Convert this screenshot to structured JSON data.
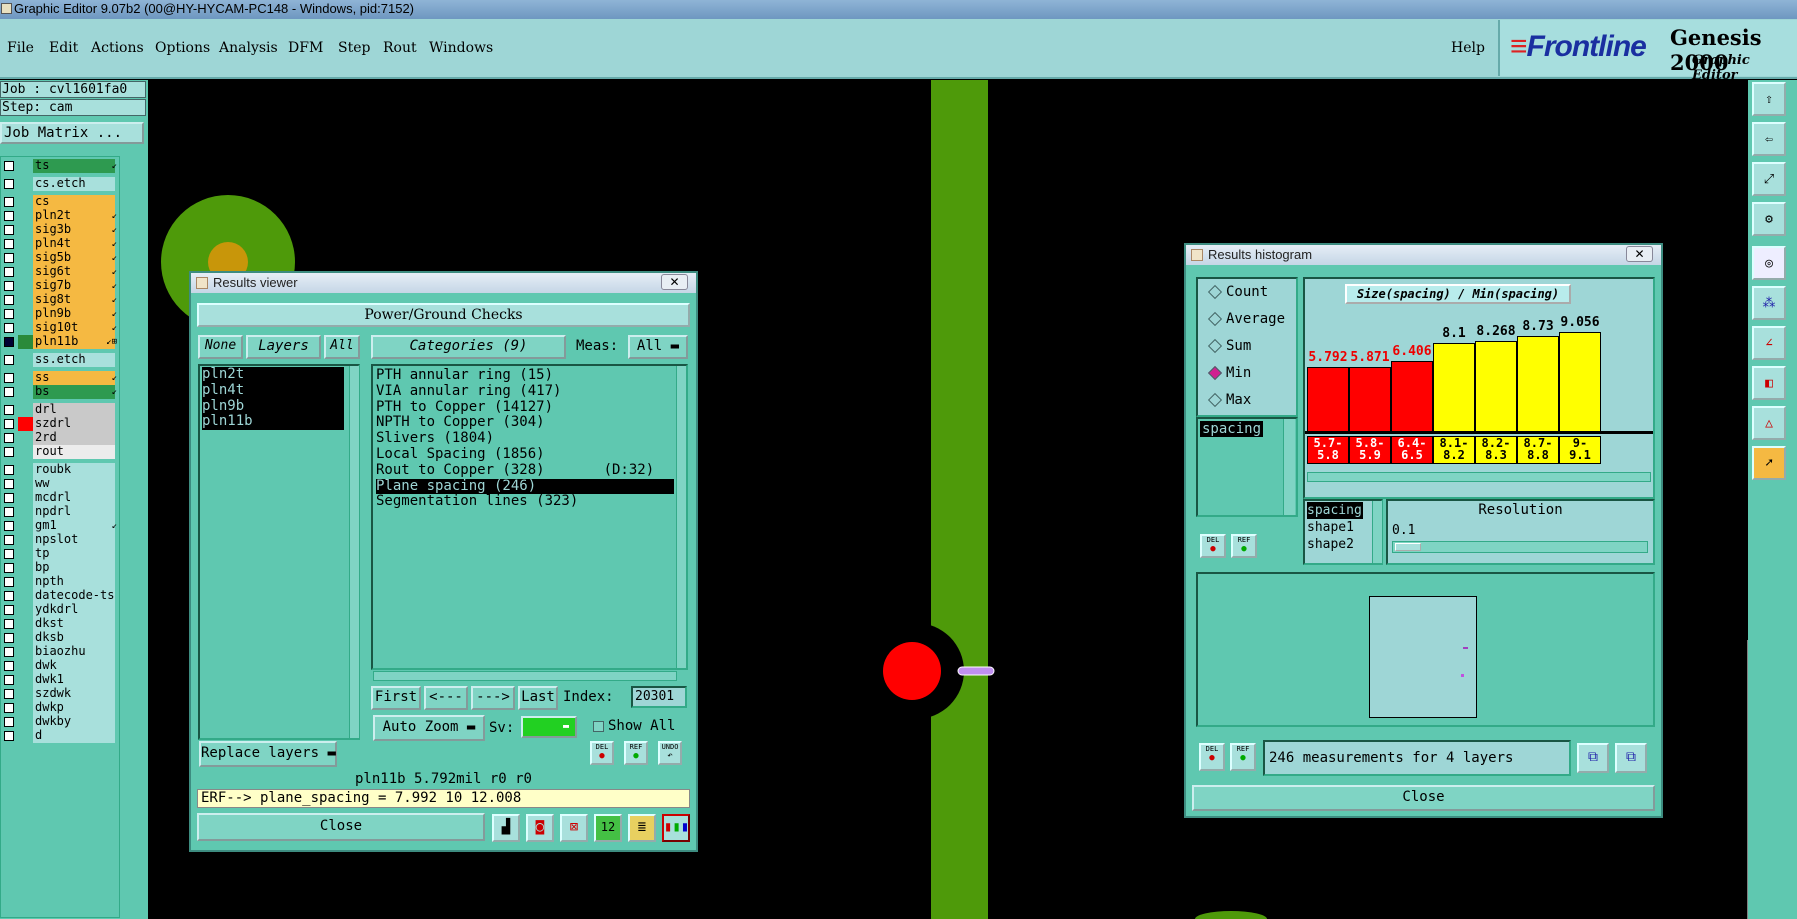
{
  "window_title": "Graphic Editor 9.07b2 (00@HY-HYCAM-PC148 - Windows, pid:7152)",
  "menu": {
    "items": [
      "File",
      "Edit",
      "Actions",
      "Options",
      "Analysis",
      "DFM",
      "Step",
      "Rout",
      "Windows"
    ],
    "help": "Help"
  },
  "logo": {
    "brand": "Frontline",
    "product": "Genesis 2000",
    "subtitle": "Graphic Editor"
  },
  "job": {
    "job_line": "Job : cvl1601fa0",
    "step_line": "Step: cam",
    "job_matrix": "Job Matrix ..."
  },
  "layers": [
    {
      "name": "ts",
      "color": "#2e9a50",
      "arrow": "↙"
    },
    {
      "name": "cs.etch",
      "color": "#a8e0dc",
      "arrow": ""
    },
    {
      "name": "cs",
      "color": "#f5b942",
      "arrow": ""
    },
    {
      "name": "pln2t",
      "color": "#f5b942",
      "arrow": "↙"
    },
    {
      "name": "sig3b",
      "color": "#f5b942",
      "arrow": "↙"
    },
    {
      "name": "pln4t",
      "color": "#f5b942",
      "arrow": "↙"
    },
    {
      "name": "sig5b",
      "color": "#f5b942",
      "arrow": "↙"
    },
    {
      "name": "sig6t",
      "color": "#f5b942",
      "arrow": "↙"
    },
    {
      "name": "sig7b",
      "color": "#f5b942",
      "arrow": "↙"
    },
    {
      "name": "sig8t",
      "color": "#f5b942",
      "arrow": "↙"
    },
    {
      "name": "pln9b",
      "color": "#f5b942",
      "arrow": "↙"
    },
    {
      "name": "sig10t",
      "color": "#f5b942",
      "arrow": "↙"
    },
    {
      "name": "pln11b",
      "color": "#f5b942",
      "arrow": "↙⊞"
    },
    {
      "name": "ss.etch",
      "color": "#a8e0dc",
      "arrow": ""
    },
    {
      "name": "ss",
      "color": "#f5b942",
      "arrow": "↙"
    },
    {
      "name": "bs",
      "color": "#2e9a50",
      "arrow": "↙"
    },
    {
      "name": "drl",
      "color": "#c9c9c9",
      "arrow": ""
    },
    {
      "name": "szdrl",
      "color": "#c9c9c9",
      "arrow": ""
    },
    {
      "name": "2rd",
      "color": "#c9c9c9",
      "arrow": ""
    },
    {
      "name": "rout",
      "color": "#ececec",
      "arrow": ""
    },
    {
      "name": "roubk",
      "color": "#a8e0dc",
      "arrow": ""
    },
    {
      "name": "ww",
      "color": "#a8e0dc",
      "arrow": ""
    },
    {
      "name": "mcdrl",
      "color": "#a8e0dc",
      "arrow": ""
    },
    {
      "name": "npdrl",
      "color": "#a8e0dc",
      "arrow": ""
    },
    {
      "name": "gm1",
      "color": "#a8e0dc",
      "arrow": "↙"
    },
    {
      "name": "npslot",
      "color": "#a8e0dc",
      "arrow": ""
    },
    {
      "name": "tp",
      "color": "#a8e0dc",
      "arrow": ""
    },
    {
      "name": "bp",
      "color": "#a8e0dc",
      "arrow": ""
    },
    {
      "name": "npth",
      "color": "#a8e0dc",
      "arrow": ""
    },
    {
      "name": "datecode-ts",
      "color": "#a8e0dc",
      "arrow": ""
    },
    {
      "name": "ydkdrl",
      "color": "#a8e0dc",
      "arrow": ""
    },
    {
      "name": "dkst",
      "color": "#a8e0dc",
      "arrow": ""
    },
    {
      "name": "dksb",
      "color": "#a8e0dc",
      "arrow": ""
    },
    {
      "name": "biaozhu",
      "color": "#a8e0dc",
      "arrow": ""
    },
    {
      "name": "dwk",
      "color": "#a8e0dc",
      "arrow": ""
    },
    {
      "name": "dwk1",
      "color": "#a8e0dc",
      "arrow": ""
    },
    {
      "name": "szdwk",
      "color": "#a8e0dc",
      "arrow": ""
    },
    {
      "name": "dwkp",
      "color": "#a8e0dc",
      "arrow": ""
    },
    {
      "name": "dwkby",
      "color": "#a8e0dc",
      "arrow": ""
    },
    {
      "name": "d",
      "color": "#a8e0dc",
      "arrow": ""
    }
  ],
  "results_viewer": {
    "title": "Results viewer",
    "close_x": "✕",
    "header": "Power/Ground Checks",
    "none_btn": "None",
    "layers_btn": "Layers",
    "all_btn": "All",
    "categories_btn": "Categories (9)",
    "meas_label": "Meas:",
    "meas_value": "All",
    "layer_items": [
      "pln2t",
      "pln4t",
      "pln9b",
      "pln11b"
    ],
    "categories": [
      "PTH annular ring (15)",
      "VIA annular ring (417)",
      "PTH to Copper (14127)",
      "NPTH to Copper (304)",
      "Slivers (1804)",
      "Local Spacing (1856)",
      "Rout to Copper (328)       (D:32)",
      "Plane spacing (246)",
      "Segmentation lines (323)"
    ],
    "selected_category": "Plane spacing (246)",
    "first_btn": "First",
    "prev_btn": "<---",
    "next_btn": "--->",
    "last_btn": "Last",
    "index_label": "Index:",
    "index_value": "20301",
    "auto_zoom": "Auto Zoom",
    "sv_label": "Sv:",
    "show_all": "Show All",
    "replace_layers": "Replace layers",
    "status_line": "pln11b 5.792mil  r0  r0",
    "erf_line": "ERF--> plane_spacing = 7.992 10 12.008",
    "close_btn": "Close",
    "del_btn": "DEL",
    "ref_btn": "REF",
    "undo_btn": "UNDO"
  },
  "histogram": {
    "title": "Results histogram",
    "close_x": "✕",
    "modes": [
      "Count",
      "Average",
      "Sum",
      "Min",
      "Max"
    ],
    "selected_mode": "Min",
    "measure_list": [
      "spacing"
    ],
    "chart_title": "Size(spacing) / Min(spacing)",
    "bars": [
      {
        "value": "5.792",
        "range": "5.7-\n5.8",
        "color": "#ff0000",
        "frac": 0.64
      },
      {
        "value": "5.871",
        "range": "5.8-\n5.9",
        "color": "#ff0000",
        "frac": 0.64
      },
      {
        "value": "6.406",
        "range": "6.4-\n6.5",
        "color": "#ff0000",
        "frac": 0.7
      },
      {
        "value": "8.1",
        "range": "8.1-\n8.2",
        "color": "#ffff00",
        "frac": 0.88
      },
      {
        "value": "8.268",
        "range": "8.2-\n8.3",
        "color": "#ffff00",
        "frac": 0.9
      },
      {
        "value": "8.73",
        "range": "8.7-\n8.8",
        "color": "#ffff00",
        "frac": 0.95
      },
      {
        "value": "9.056",
        "range": "9-\n9.1",
        "color": "#ffff00",
        "frac": 0.99
      }
    ],
    "shape_list": [
      "spacing",
      "shape1",
      "shape2"
    ],
    "resolution_label": "Resolution",
    "resolution_value": "0.1",
    "summary": "246 measurements for 4 layers",
    "close_btn": "Close",
    "del_btn": "DEL",
    "ref_btn": "REF"
  },
  "colors": {
    "panel": "#5fc8b0",
    "menu": "#9ed6d6",
    "trace": "#4e9a0a",
    "highlight": "#ff0000"
  }
}
